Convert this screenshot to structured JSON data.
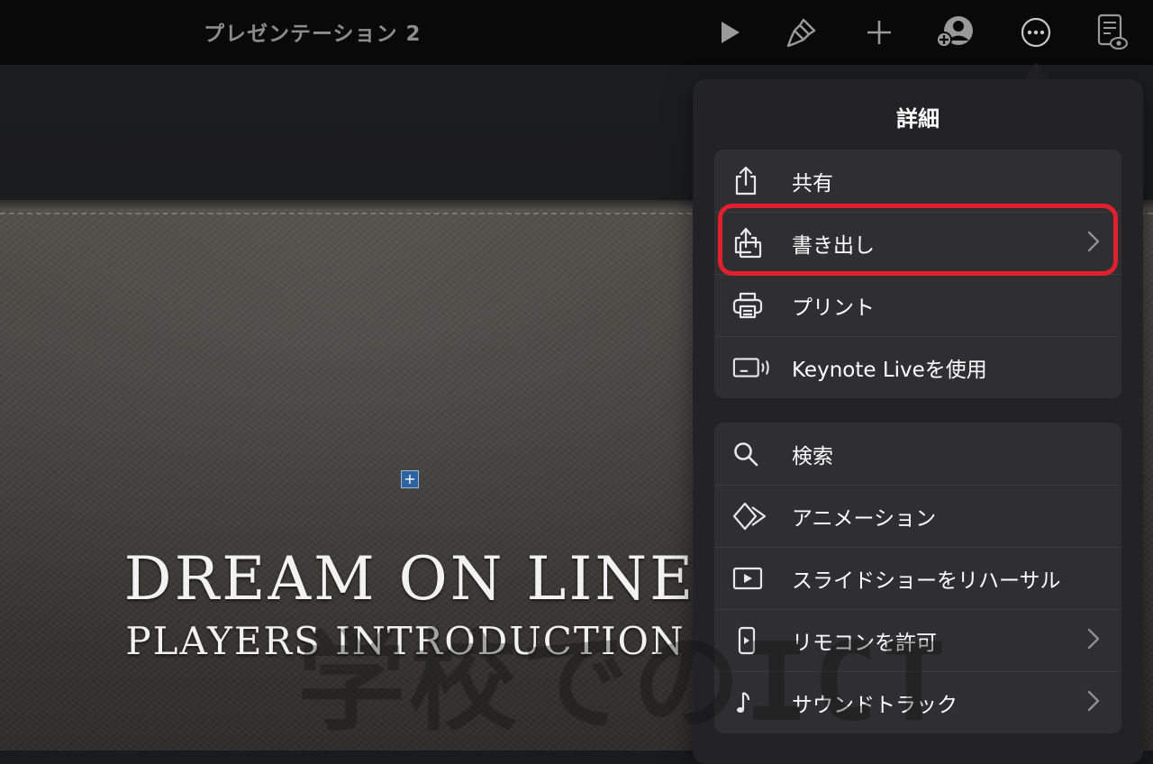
{
  "toolbar": {
    "title": "プレゼンテーション 2",
    "buttons": [
      {
        "icon": "play-icon"
      },
      {
        "icon": "paintbrush-icon"
      },
      {
        "icon": "plus-icon"
      },
      {
        "icon": "collaborate-icon"
      },
      {
        "icon": "more-icon"
      },
      {
        "icon": "presenter-notes-icon"
      }
    ]
  },
  "slide": {
    "title": "DREAM ON LINE",
    "subtitle": "PLAYERS INTRODUCTION",
    "handle_symbol": "+"
  },
  "watermark": "学校でのICT",
  "popover": {
    "title": "詳細",
    "group1": [
      {
        "label": "共有",
        "icon": "share-icon",
        "chevron": false
      },
      {
        "label": "書き出し",
        "icon": "export-icon",
        "chevron": true,
        "highlighted": true
      },
      {
        "label": "プリント",
        "icon": "printer-icon",
        "chevron": false
      },
      {
        "label": "Keynote Liveを使用",
        "icon": "keynote-live-icon",
        "chevron": false
      }
    ],
    "group2": [
      {
        "label": "検索",
        "icon": "search-icon",
        "chevron": false
      },
      {
        "label": "アニメーション",
        "icon": "animation-icon",
        "chevron": false
      },
      {
        "label": "スライドショーをリハーサル",
        "icon": "rehearse-icon",
        "chevron": false
      },
      {
        "label": "リモコンを許可",
        "icon": "remote-icon",
        "chevron": true
      },
      {
        "label": "サウンドトラック",
        "icon": "music-note-icon",
        "chevron": true
      }
    ]
  },
  "colors": {
    "toolbar_bg": "#090909",
    "popover_bg": "#232325",
    "group_bg": "#2f2f31",
    "highlight": "#e0202e",
    "icon": "#e8e8e8"
  }
}
